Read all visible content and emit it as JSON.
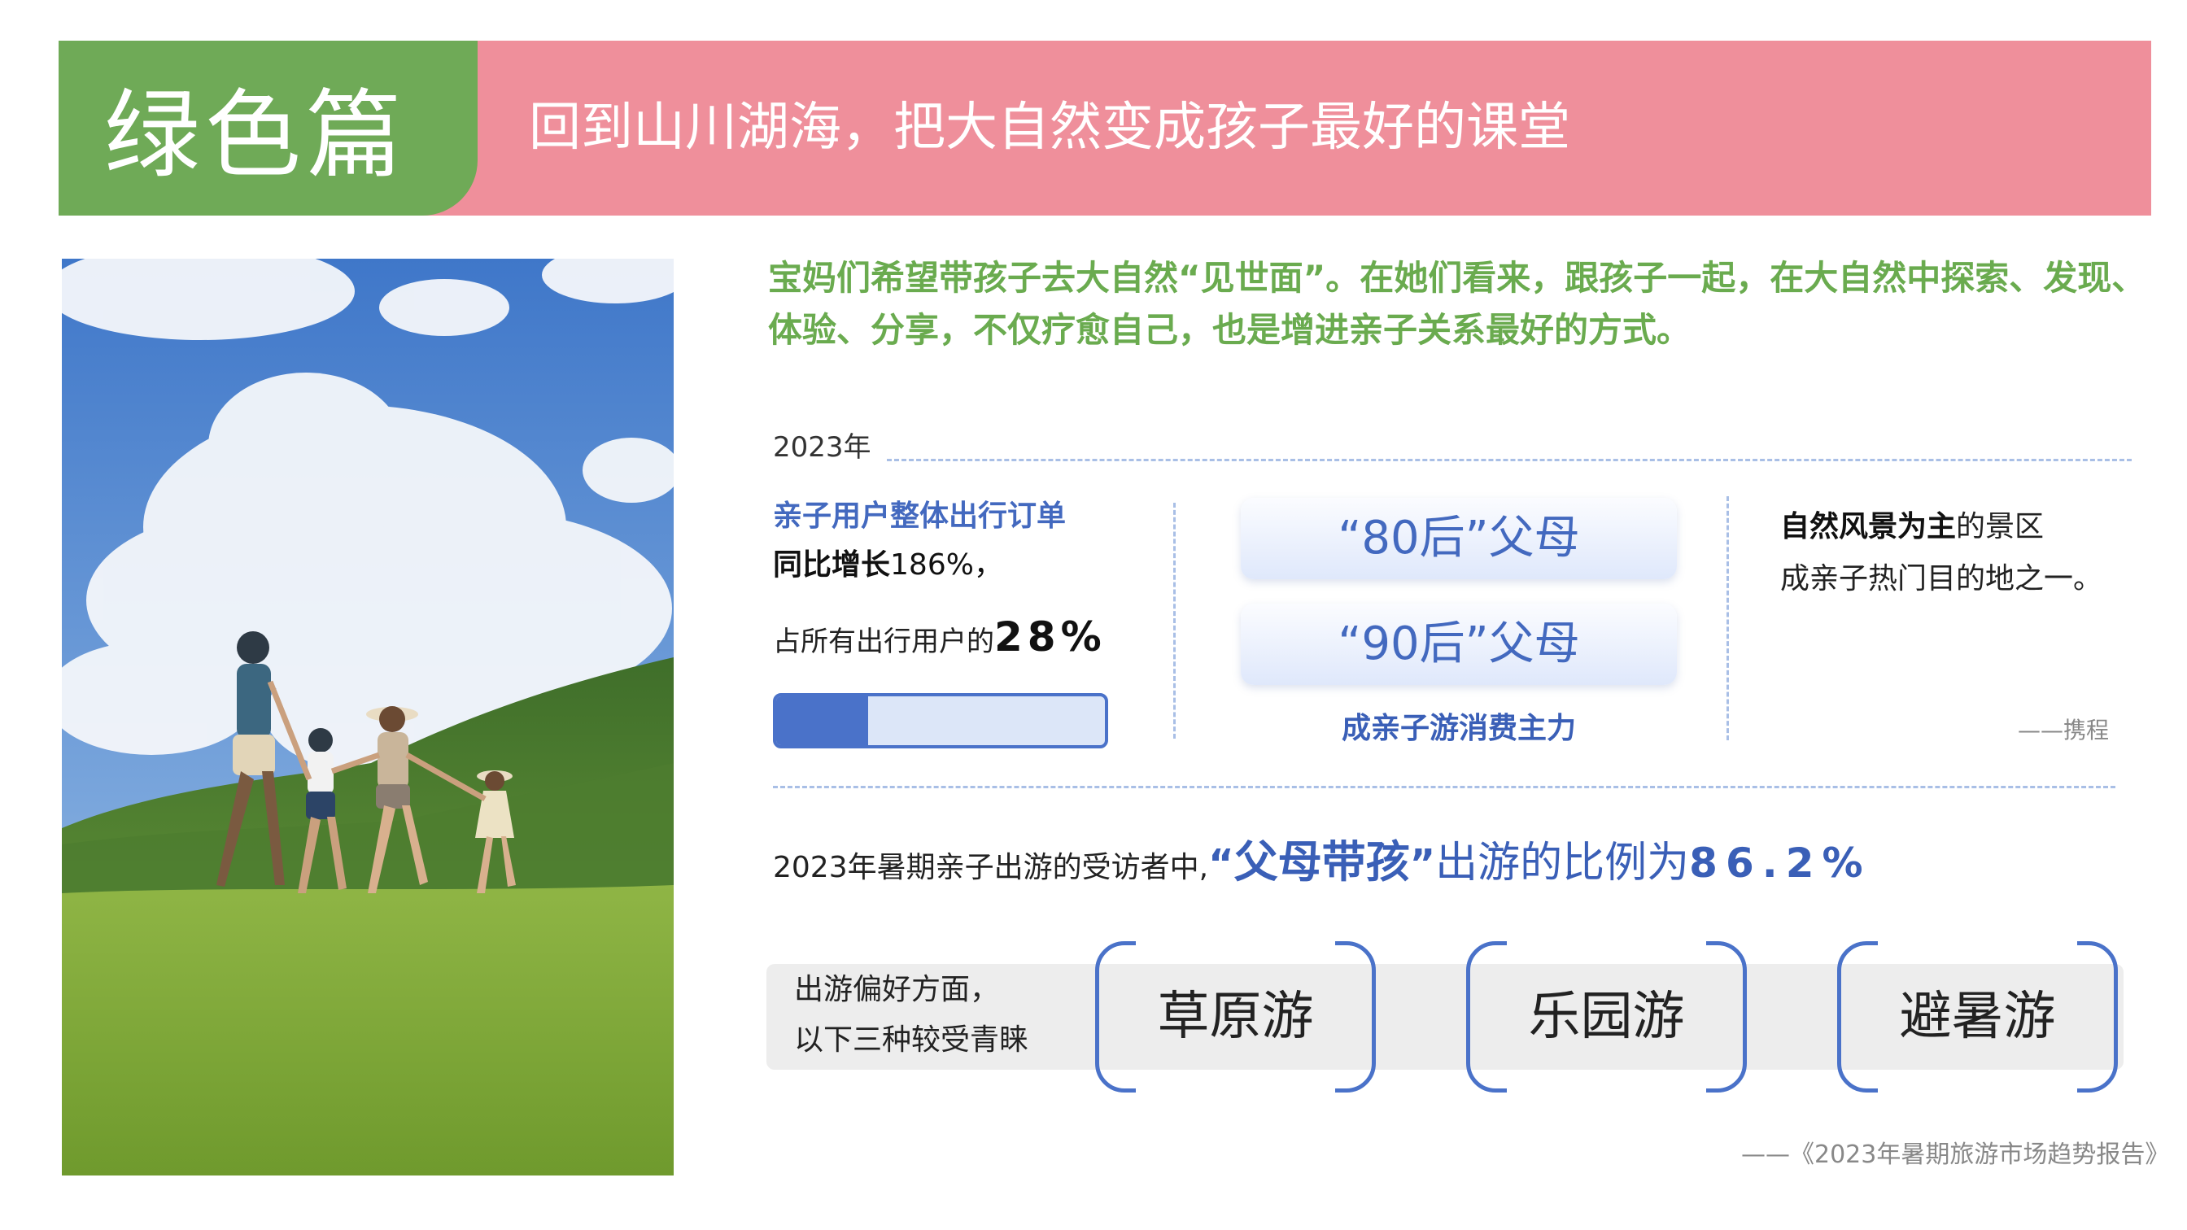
{
  "header": {
    "title": "绿色篇",
    "subtitle": "回到山川湖海，把大自然变成孩子最好的课堂"
  },
  "intro": "宝妈们希望带孩子去大自然“见世面”。在她们看来，跟孩子一起，在大自然中探索、发现、体验、分享，不仅疗愈自己，也是增进亲子关系最好的方式。",
  "stats": {
    "year": "2023年",
    "stat1": {
      "line1": "亲子用户整体出行订单",
      "line2_bold": "同比增长",
      "line2_value": "186%，",
      "line3_text": "占所有出行用户的",
      "line3_value": "28%",
      "progress": 0.28
    },
    "stat2": {
      "pill1": "“80后”父母",
      "pill2": "“90后”父母",
      "caption": "成亲子游消费主力"
    },
    "stat3": {
      "bold": "自然风景为主",
      "rest1": "的景区",
      "rest2": "成亲子热门目的地之一。",
      "source": "——携程"
    }
  },
  "ratio": {
    "prefix": "2023年暑期亲子出游的受访者中,",
    "open_quote": "“",
    "keyword": "父母带孩",
    "close_quote": "”",
    "middle": "出游的比例为",
    "value": "86.2%"
  },
  "preference": {
    "label1": "出游偏好方面，",
    "label2": "以下三种较受青睐",
    "items": [
      "草原游",
      "乐园游",
      "避暑游"
    ]
  },
  "source": "——《2023年暑期旅游市场趋势报告》",
  "colors": {
    "green": "#6faa57",
    "pink": "#ef8f9b",
    "blue": "#4369bf"
  }
}
